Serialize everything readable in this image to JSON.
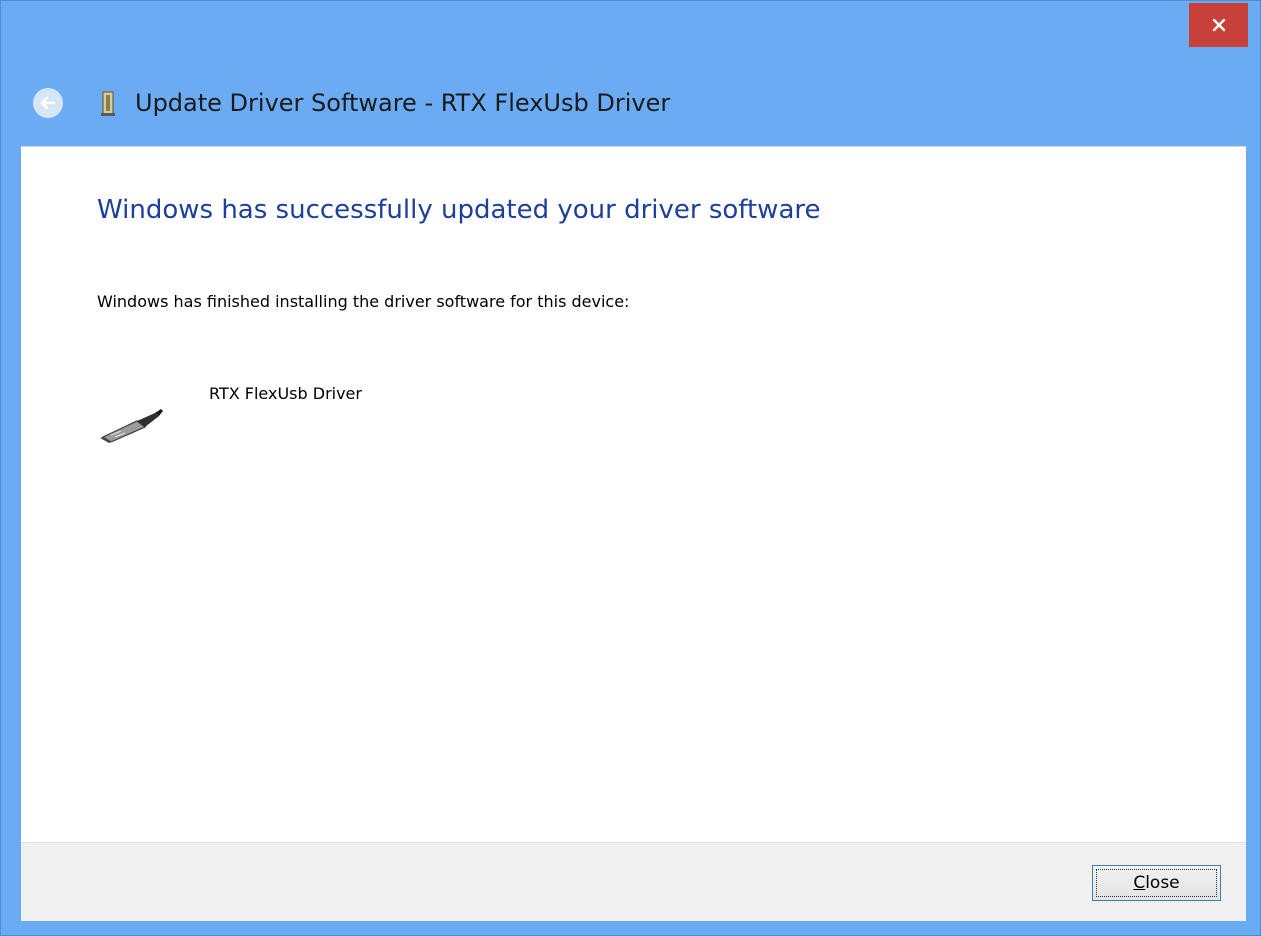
{
  "window": {
    "title": "Update Driver Software - RTX FlexUsb Driver"
  },
  "colors": {
    "title_bar": "#6aabf4",
    "close_hover": "#c7403a",
    "heading": "#1e3f9a",
    "footer": "#f0f0f0"
  },
  "icons": {
    "close": "close-icon",
    "back": "back-arrow-icon",
    "title": "device-icon",
    "device": "usb-plug-icon"
  },
  "content": {
    "heading": "Windows has successfully updated your driver software",
    "message": "Windows has finished installing the driver software for this device:",
    "device_name": "RTX FlexUsb Driver"
  },
  "footer": {
    "close_label_mnemonic": "C",
    "close_label_rest": "lose"
  }
}
